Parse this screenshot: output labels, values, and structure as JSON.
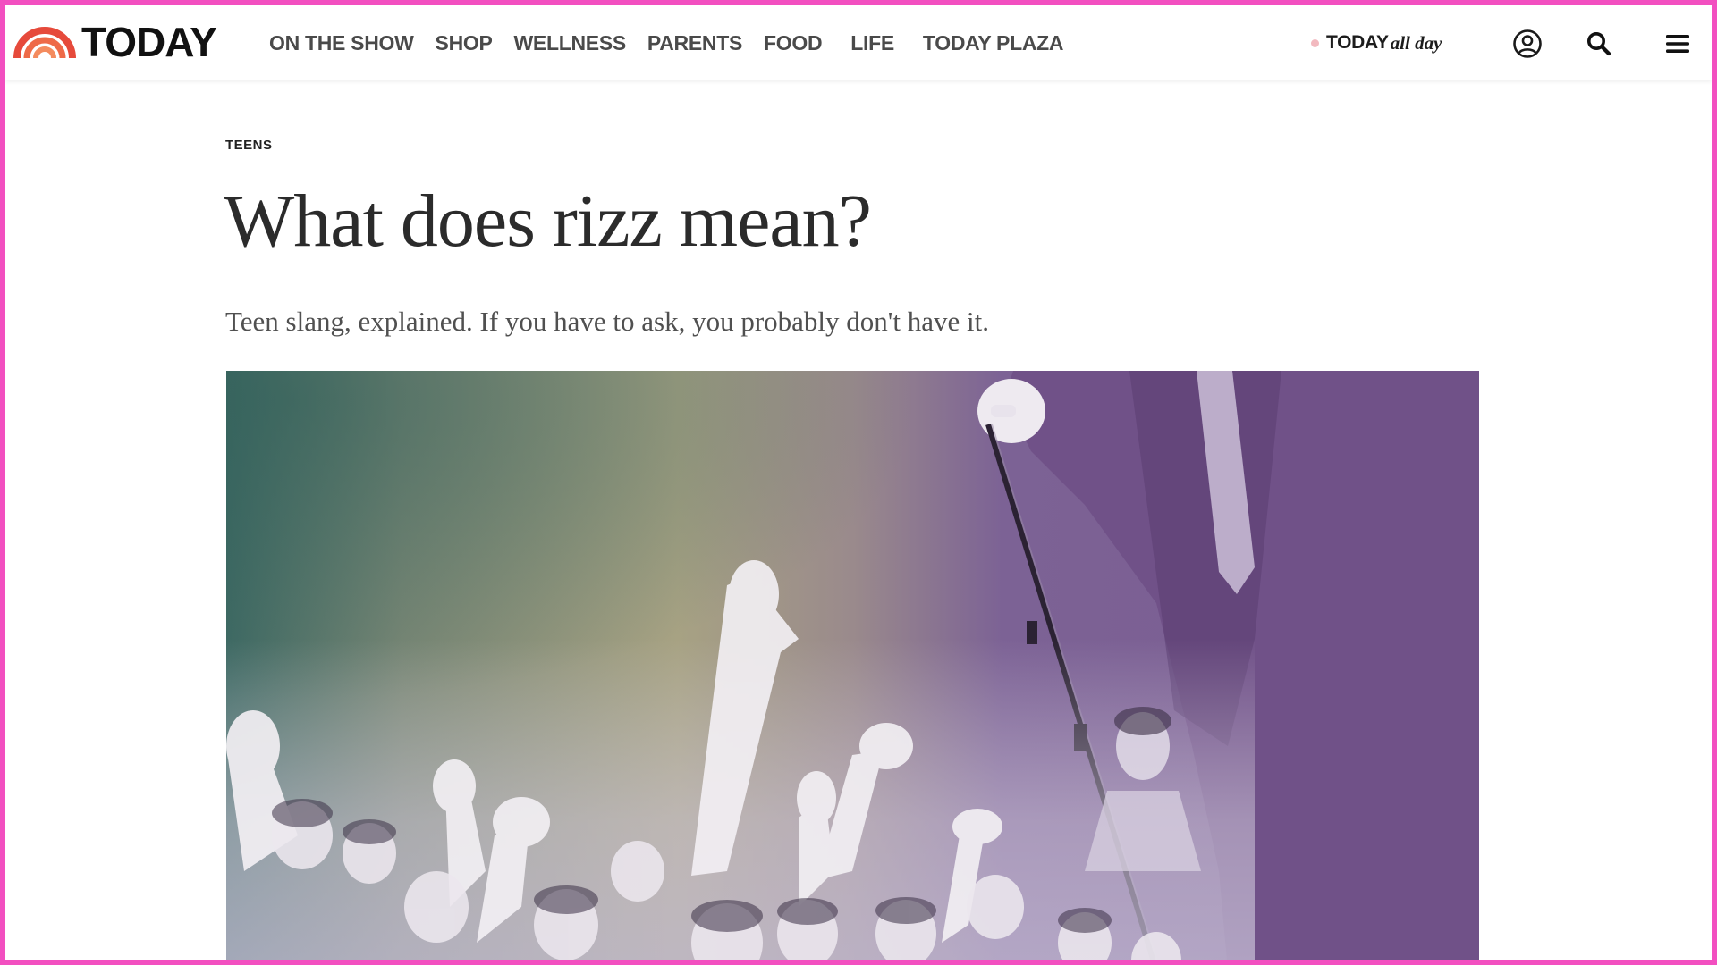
{
  "header": {
    "brand": "TODAY",
    "nav": [
      {
        "label": "ON THE SHOW"
      },
      {
        "label": "SHOP"
      },
      {
        "label": "WELLNESS"
      },
      {
        "label": "PARENTS"
      },
      {
        "label": "FOOD"
      },
      {
        "label": "LIFE"
      },
      {
        "label": "TODAY PLAZA"
      }
    ],
    "all_day_brand": "TODAY",
    "all_day_sub": "all day",
    "icons": {
      "account": "user-circle-icon",
      "search": "search-icon",
      "menu": "hamburger-menu-icon"
    }
  },
  "article": {
    "section": "TEENS",
    "headline": "What does rizz mean?",
    "dek": "Teen slang, explained. If you have to ask, you probably don't have it."
  },
  "colors": {
    "frame_border": "#f24fc0",
    "logo_rainbow": [
      "#e94b3c",
      "#f06a4a",
      "#f58d62"
    ],
    "hero_tint_left": "#3e6b63",
    "hero_tint_mid": "#a6a281",
    "hero_tint_right": "#7a5e92"
  }
}
